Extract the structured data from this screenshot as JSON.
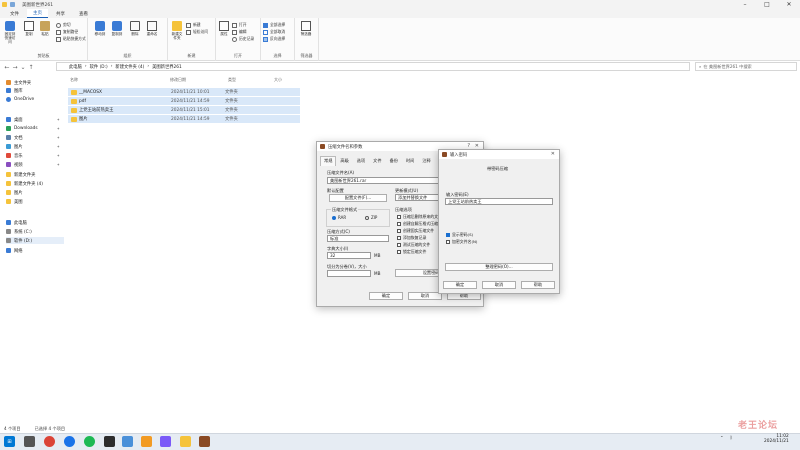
{
  "window": {
    "title": "美图新世界261"
  },
  "menu_tabs": [
    "文件",
    "主页",
    "共享",
    "查看"
  ],
  "ribbon": {
    "groups": {
      "clipboard": "剪贴板",
      "organize": "组织",
      "new": "新建",
      "open": "打开",
      "select": "选择",
      "filter": "筛选器"
    },
    "pin_label": "固定到快速访问",
    "copy_label": "复制",
    "paste_label": "粘贴",
    "cut_label": "剪切",
    "copy_path_label": "复制路径",
    "paste_shortcut_label": "粘贴快捷方式",
    "move_to_label": "移动到",
    "copy_to_label": "复制到",
    "delete_label": "删除",
    "rename_label": "重命名",
    "new_folder_label": "新建文件夹",
    "new_item_label": "新建",
    "easy_access_label": "轻松访问",
    "properties_label": "属性",
    "open_label": "打开",
    "edit_label": "编辑",
    "history_label": "历史记录",
    "select_all_label": "全部选择",
    "select_none_label": "全部取消",
    "invert_label": "反向选择",
    "filter_label": "筛选器"
  },
  "address": {
    "crumbs": [
      "此电脑",
      "软件 (D:)",
      "新建文件夹 (4)",
      "美图新世界261"
    ],
    "search_placeholder": "在 美图新世界261 中搜索"
  },
  "nav": {
    "items": [
      {
        "label": "主文件夹"
      },
      {
        "label": "图库"
      },
      {
        "label": "OneDrive"
      },
      {
        "label": "桌面",
        "pin": "✦"
      },
      {
        "label": "Downloads",
        "pin": "✦"
      },
      {
        "label": "文档",
        "pin": "✦"
      },
      {
        "label": "图片",
        "pin": "✦"
      },
      {
        "label": "音乐",
        "pin": "✦"
      },
      {
        "label": "视频",
        "pin": "✦"
      },
      {
        "label": "新建文件夹"
      },
      {
        "label": "新建文件夹 (4)"
      },
      {
        "label": "图片"
      },
      {
        "label": "美图"
      },
      {
        "label": "此电脑"
      },
      {
        "label": "系统 (C:)"
      },
      {
        "label": "软件 (D:)"
      },
      {
        "label": "网络"
      }
    ]
  },
  "columns": [
    "名称",
    "修改日期",
    "类型",
    "大小"
  ],
  "files": [
    {
      "name": "__MACOSX",
      "date": "2024/11/21 10:01",
      "type": "文件夹"
    },
    {
      "name": "pdf",
      "date": "2024/11/21 14:59",
      "type": "文件夹"
    },
    {
      "name": "上党王站前热卖王",
      "date": "2024/11/21 15:01",
      "type": "文件夹"
    },
    {
      "name": "图片",
      "date": "2024/11/21 14:59",
      "type": "文件夹"
    }
  ],
  "status": {
    "count": "4 个项目",
    "selected": "已选择 4 个项目"
  },
  "archive_dialog": {
    "title": "压缩文件名和参数",
    "tabs": [
      "常规",
      "高级",
      "选项",
      "文件",
      "备份",
      "时间",
      "注释"
    ],
    "archive_name_label": "压缩文件名(A)",
    "archive_name_value": "美图新世界261.rar",
    "default_profile_label": "默认配置",
    "profiles_button": "配置文件(F)...",
    "update_mode_label": "更新模式(U)",
    "update_mode_value": "添加并替换文件",
    "format_label": "压缩文件格式",
    "format_rar": "RAR",
    "format_zip": "ZIP",
    "options_label": "压缩选项",
    "options": [
      "压缩后删除原来的文件",
      "创建自解压格式压缩文件",
      "创建固实压缩文件",
      "添加恢复记录",
      "测试压缩的文件",
      "锁定压缩文件"
    ],
    "method_label": "压缩方式(C)",
    "method_value": "标准",
    "dict_label": "字典大小(I)",
    "dict_value": "32",
    "dict_unit": "MB",
    "split_label": "切分为分卷(V)，大小",
    "split_unit": "MB",
    "set_password_button": "设置密码(P)...",
    "ok": "确定",
    "cancel": "取消",
    "help": "帮助"
  },
  "password_dialog": {
    "title": "输入密码",
    "heading": "带密码压缩",
    "enter_label": "输入密码(E)",
    "password_value": "上党王站前热卖王",
    "show_password": "显示密码(S)",
    "encrypt_names": "加密文件名(N)",
    "organize_button": "整理密码(O)...",
    "ok": "确定",
    "cancel": "取消",
    "help": "帮助"
  },
  "taskbar": {
    "time": "11:02",
    "date": "2024/11/21"
  },
  "watermark": "老王论坛"
}
